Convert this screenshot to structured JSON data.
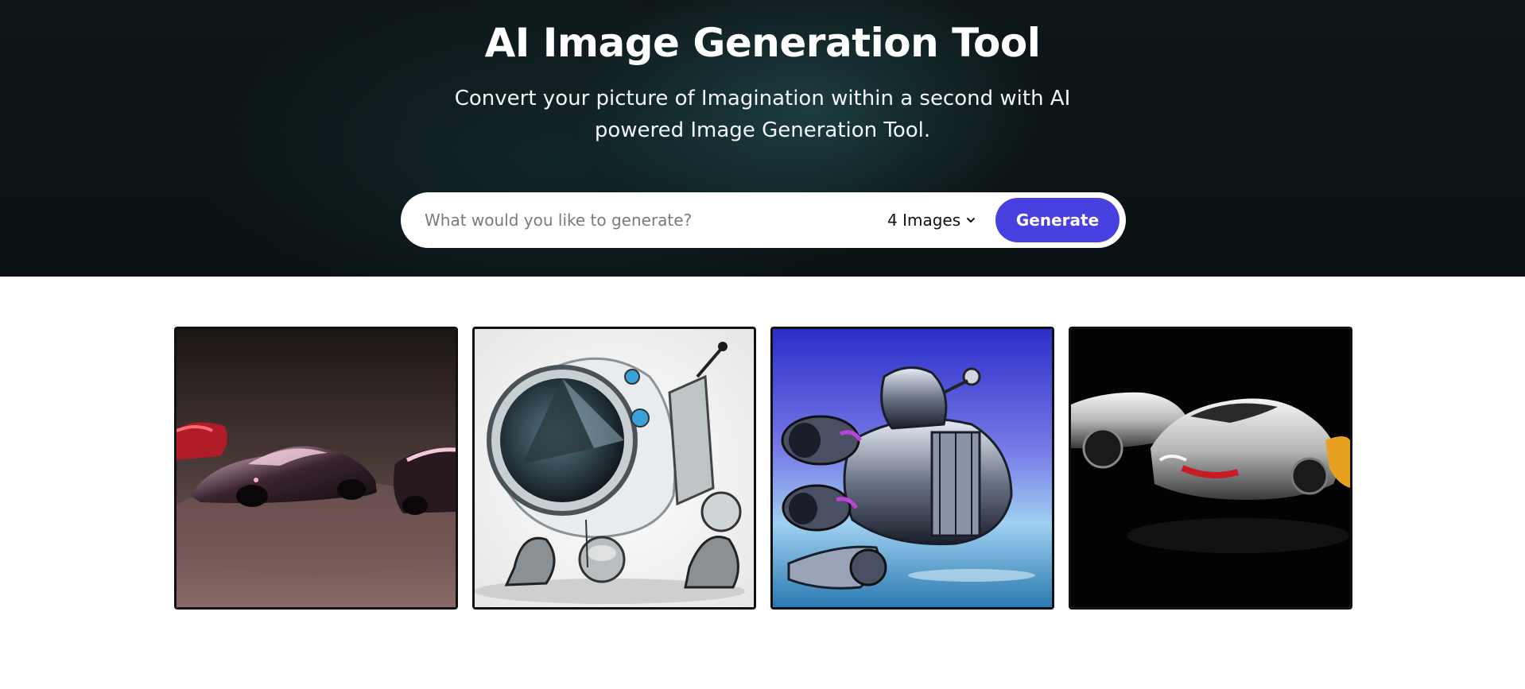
{
  "hero": {
    "title": "AI Image Generation Tool",
    "subtitle": "Convert your picture of Imagination within a second with AI powered Image Generation Tool."
  },
  "search": {
    "placeholder": "What would you like to generate?",
    "value": "",
    "count_selected": "4 Images",
    "count_icon": "chevron-down-icon",
    "generate_label": "Generate",
    "accent_color": "#4840e0"
  },
  "gallery": {
    "images": [
      {
        "subject": "futuristic pink sports car"
      },
      {
        "subject": "chrome robot with round lens"
      },
      {
        "subject": "metallic spaceship on blue sky"
      },
      {
        "subject": "silver concept cars on black"
      }
    ]
  }
}
